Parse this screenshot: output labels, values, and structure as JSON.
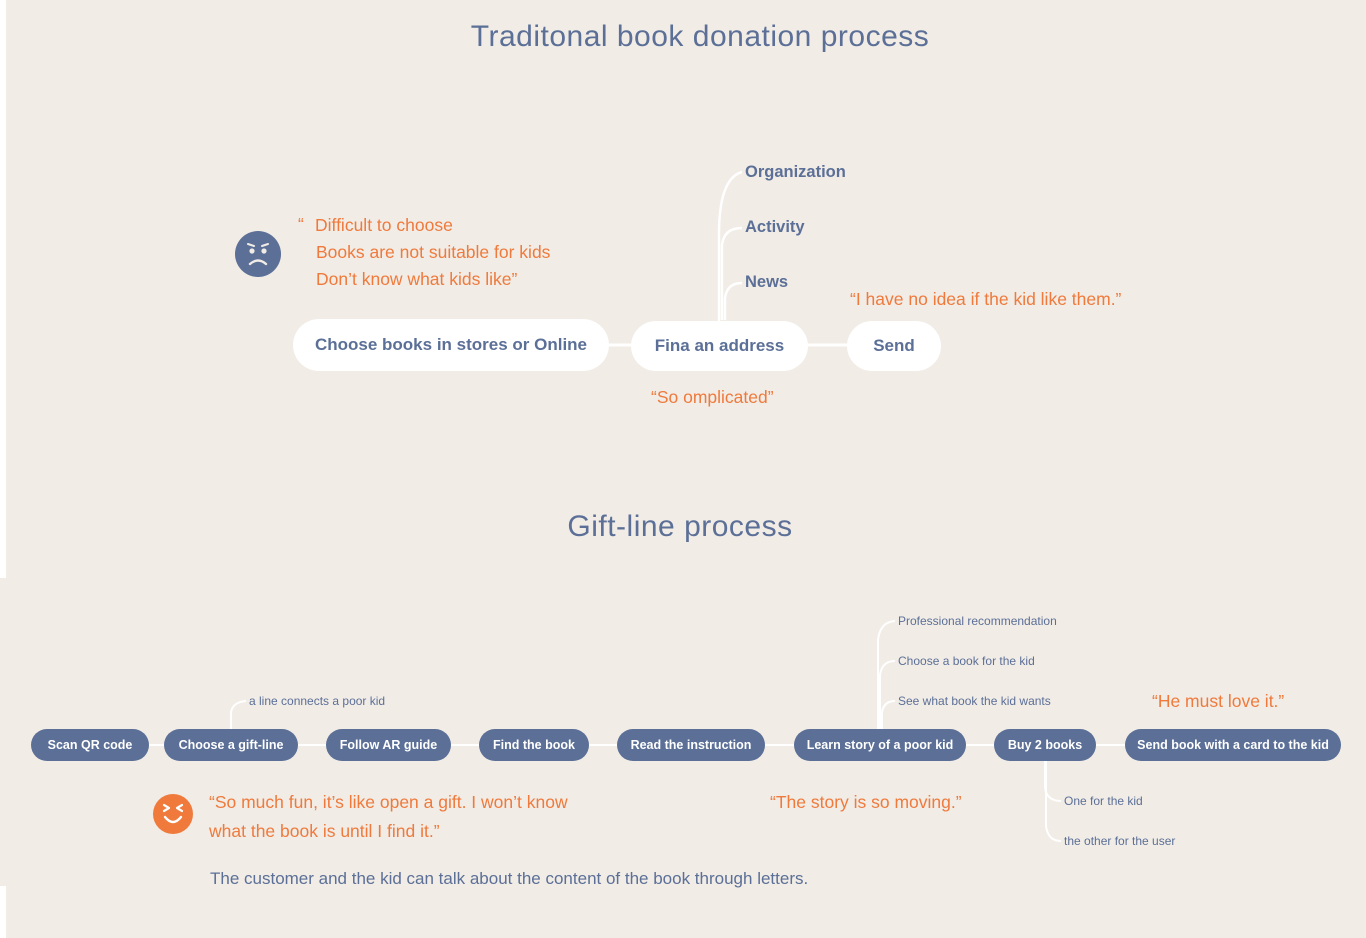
{
  "traditional": {
    "title": "Traditonal book donation process",
    "steps": [
      "Choose books in stores or Online",
      "Fina an address",
      "Send"
    ],
    "address_branches": [
      "Organization",
      "Activity",
      "News"
    ],
    "pain_quote": {
      "open": "“",
      "lines": [
        "Difficult to choose",
        "Books are not suitable for kids",
        "Don’t know what kids like”"
      ]
    },
    "quote_complicated": "“So omplicated”",
    "quote_send": "“I have no idea if the kid like them.”",
    "sad_face_icon": "sad-face-icon",
    "colors": {
      "accent": "#5b6f97",
      "quote": "#ef7a3c",
      "background": "#f1ece6"
    }
  },
  "giftline": {
    "title": "Gift-line process",
    "steps": [
      "Scan QR code",
      "Choose a gift-line",
      "Follow AR guide",
      "Find the book",
      "Read the instruction",
      "Learn story of a poor kid",
      "Buy 2 books",
      "Send book with a card to the kid"
    ],
    "giftline_branch": "a line connects a poor kid",
    "story_branches": [
      "Professional recommendation",
      "Choose a book for the kid",
      "See what book the kid wants"
    ],
    "buy_branches": [
      "One for the kid",
      "the other for the user"
    ],
    "quote_fun": [
      "“So much fun, it’s like open a gift. I won’t know",
      "what the book is until I find it.”"
    ],
    "quote_story": "“The story is so moving.”",
    "quote_love": "“He must love it.”",
    "note": "The customer and the kid can talk about the content of the book through letters.",
    "happy_face_icon": "happy-face-icon"
  }
}
